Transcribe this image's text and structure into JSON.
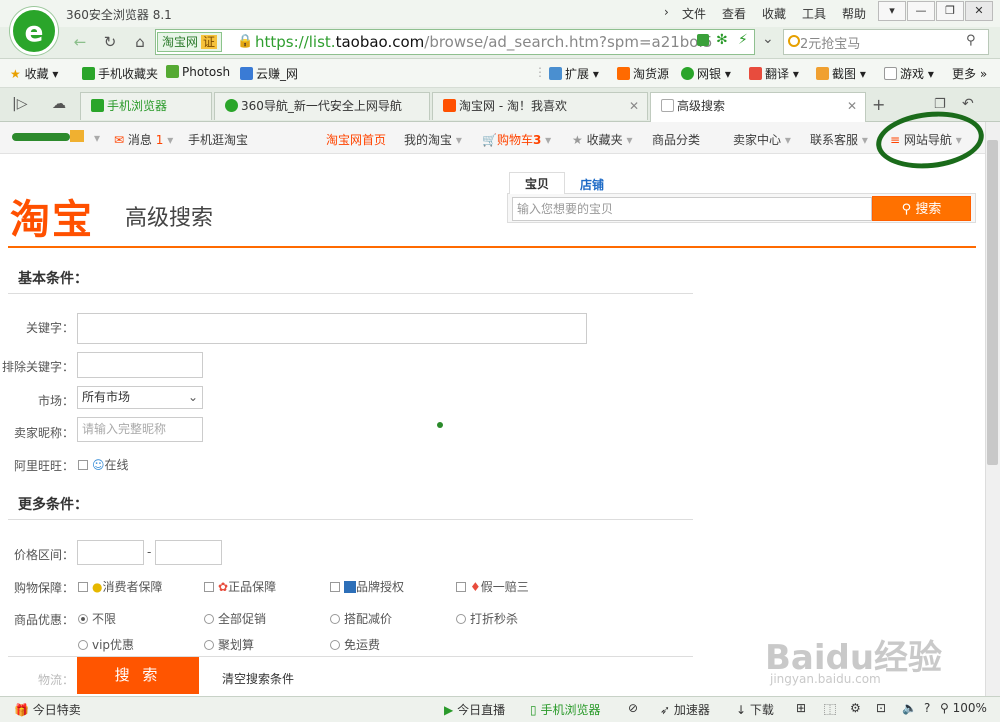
{
  "app": {
    "title": "360安全浏览器 8.1",
    "logo_glyph": "e"
  },
  "menu": [
    "文件",
    "查看",
    "收藏",
    "工具",
    "帮助"
  ],
  "window_buttons": [
    "▾",
    "—",
    "❐",
    "✕"
  ],
  "address": {
    "site_label": "淘宝网",
    "cert_label": "证",
    "url_scheme": "https://list.",
    "url_domain": "taobao.com",
    "url_path": "/browse/ad_search.htm?spm=a21bo.5",
    "search_placeholder": "2元抢宝马"
  },
  "bookmarks_left": [
    "收藏",
    "手机收藏夹",
    "Photosh",
    "云赚_网"
  ],
  "bookmarks_right": [
    "扩展",
    "淘货源",
    "网银",
    "翻译",
    "截图",
    "游戏",
    "更多"
  ],
  "tabs": [
    {
      "label": "手机浏览器"
    },
    {
      "label": "360导航_新一代安全上网导航"
    },
    {
      "label": "淘宝网 - 淘！我喜欢"
    },
    {
      "label": "高级搜索"
    }
  ],
  "taobao_bar": {
    "msg": "消息",
    "msg_count": "1",
    "mobile": "手机逛淘宝",
    "home": "淘宝网首页",
    "mine": "我的淘宝",
    "cart": "购物车",
    "cart_count": "3",
    "fav": "收藏夹",
    "category": "商品分类",
    "seller": "卖家中心",
    "service": "联系客服",
    "sitenav": "网站导航"
  },
  "header": {
    "logo": "淘宝",
    "subtitle": "高级搜索",
    "tab_item": "宝贝",
    "tab_shop": "店铺",
    "search_placeholder": "输入您想要的宝贝",
    "search_button": "搜索"
  },
  "basic": {
    "title": "基本条件：",
    "keyword_label": "关键字：",
    "exclude_label": "排除关键字：",
    "market_label": "市场：",
    "market_value": "所有市场",
    "seller_label": "卖家昵称：",
    "seller_placeholder": "请输入完整昵称",
    "wangwang_label": "阿里旺旺：",
    "online": "在线"
  },
  "more": {
    "title": "更多条件：",
    "price_label": "价格区间：",
    "price_sep": "-",
    "guarantee_label": "购物保障：",
    "guarantees": [
      "消费者保障",
      "正品保障",
      "品牌授权",
      "假一赔三"
    ],
    "promo_label": "商品优惠：",
    "promos_row1": [
      "不限",
      "全部促销",
      "搭配减价",
      "打折秒杀"
    ],
    "promos_row2": [
      "vip优惠",
      "聚划算",
      "免运费"
    ],
    "logistics_label": "物流：",
    "search_button": "搜 索",
    "clear": "清空搜索条件"
  },
  "status": {
    "today_deal": "今日特卖",
    "live": "今日直播",
    "mobile": "手机浏览器",
    "accel": "加速器",
    "download": "下载",
    "zoom": "100%"
  },
  "watermark": {
    "brand": "Baidu经验",
    "url": "jingyan.baidu.com"
  },
  "colors": {
    "accent": "#ff5000",
    "browser_green": "#2aa52a",
    "annotation": "#1a6b1a"
  }
}
